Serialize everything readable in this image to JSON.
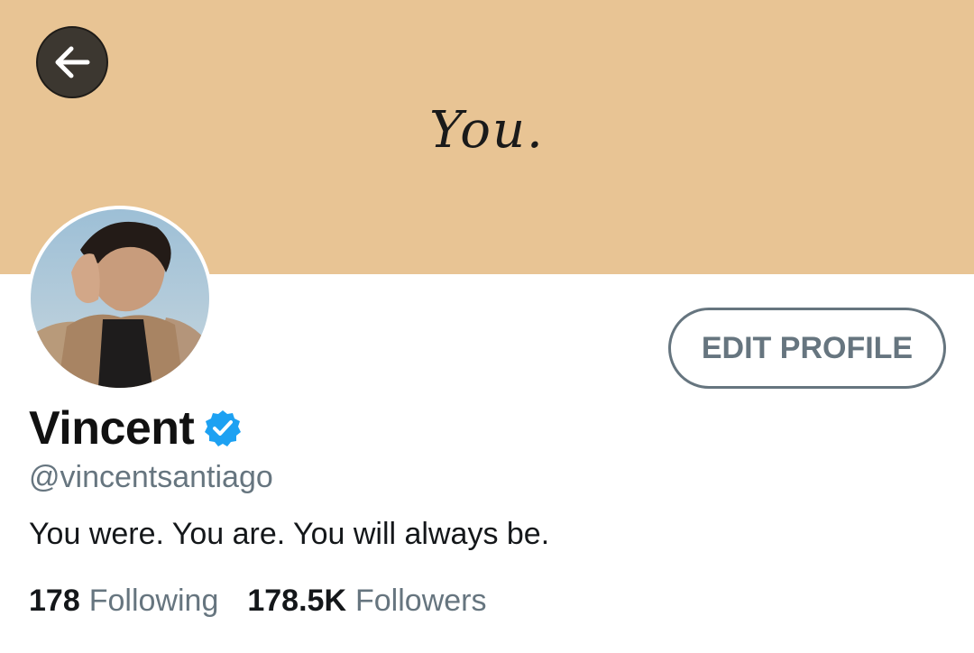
{
  "banner": {
    "text": "You.",
    "color": "#e8c494"
  },
  "back_button": {
    "icon": "arrow-left-icon"
  },
  "profile": {
    "name": "Vincent",
    "verified_icon": "verified-badge-icon",
    "handle": "@vincentsantiago",
    "bio": "You were. You are. You will always be.",
    "edit_label": "EDIT PROFILE"
  },
  "stats": {
    "following_count": "178",
    "following_label": "Following",
    "followers_count": "178.5K",
    "followers_label": "Followers"
  },
  "colors": {
    "accent_blue": "#1da1f2",
    "secondary_text": "#66757f",
    "primary_text": "#14171a"
  }
}
